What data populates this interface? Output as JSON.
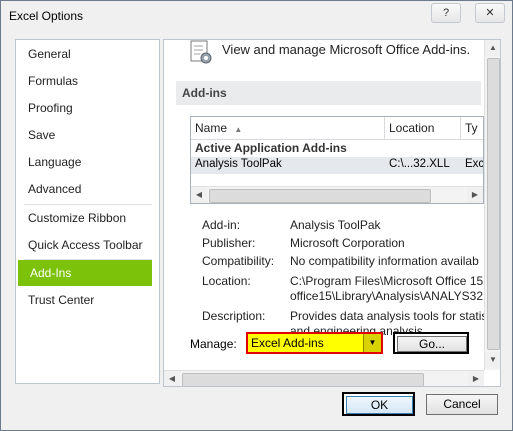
{
  "window": {
    "title": "Excel Options",
    "help_label": "?",
    "close_label": "✕"
  },
  "sidebar": {
    "items": [
      {
        "label": "General"
      },
      {
        "label": "Formulas"
      },
      {
        "label": "Proofing"
      },
      {
        "label": "Save"
      },
      {
        "label": "Language"
      },
      {
        "label": "Advanced"
      },
      {
        "label": "Customize Ribbon"
      },
      {
        "label": "Quick Access Toolbar"
      },
      {
        "label": "Add-Ins"
      },
      {
        "label": "Trust Center"
      }
    ],
    "active": "Add-Ins",
    "accent_color": "#7cc20a"
  },
  "main": {
    "header": "View and manage Microsoft Office Add-ins.",
    "section_title": "Add-ins",
    "table": {
      "columns": [
        "Name",
        "Location",
        "Ty"
      ],
      "group": "Active Application Add-ins",
      "rows": [
        {
          "name": "Analysis ToolPak",
          "location": "C:\\...32.XLL",
          "type": "Exc"
        }
      ]
    },
    "details": {
      "addin_label": "Add-in:",
      "addin_value": "Analysis ToolPak",
      "publisher_label": "Publisher:",
      "publisher_value": "Microsoft Corporation",
      "compat_label": "Compatibility:",
      "compat_value": "No compatibility information availab",
      "location_label": "Location:",
      "location_value_1": "C:\\Program Files\\Microsoft Office 15",
      "location_value_2": "office15\\Library\\Analysis\\ANALYS32",
      "desc_label": "Description:",
      "desc_value_1": "Provides data analysis tools for statis",
      "desc_value_2": "and engineering analysis"
    },
    "manage": {
      "label": "Manage:",
      "value": "Excel Add-ins",
      "go_label": "Go..."
    }
  },
  "footer": {
    "ok_label": "OK",
    "cancel_label": "Cancel"
  }
}
